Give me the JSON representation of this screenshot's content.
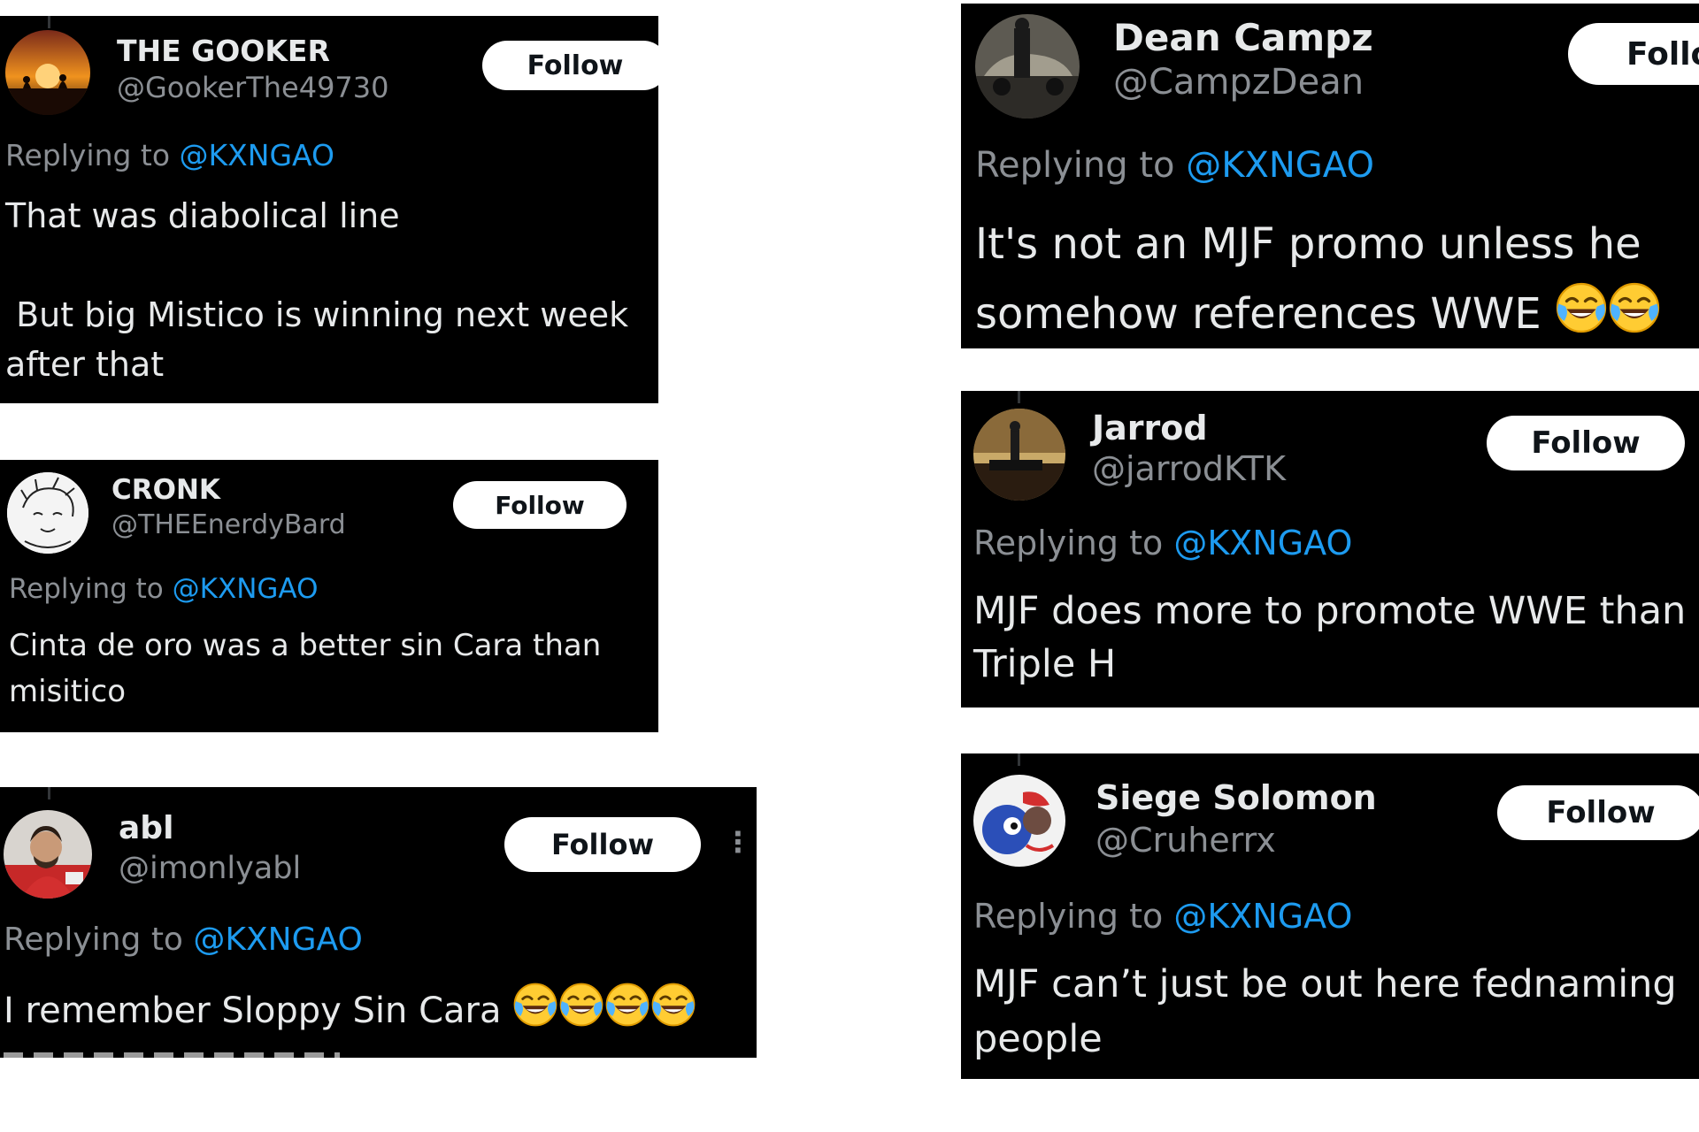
{
  "tweets": {
    "gooker": {
      "name": "THE GOOKER",
      "handle": "@GookerThe49730",
      "follow": "Follow",
      "replying_prefix": "Replying to ",
      "mention": "@KXNGAO",
      "line1": "That was diabolical line",
      "line2": " But big Mistico is winning next week",
      "line3": "after that"
    },
    "cronk": {
      "name": "CRONK",
      "handle": "@THEEnerdyBard",
      "follow": "Follow",
      "replying_prefix": "Replying to ",
      "mention": "@KXNGAO",
      "line1": "Cinta de oro was a better sin Cara than",
      "line2": "misitico"
    },
    "abl": {
      "name": "abl",
      "handle": "@imonlyabl",
      "follow": "Follow",
      "replying_prefix": "Replying to ",
      "mention": "@KXNGAO",
      "line1": "I remember Sloppy Sin Cara"
    },
    "dean": {
      "name": "Dean Campz",
      "handle": "@CampzDean",
      "follow": "Follo",
      "replying_prefix": "Replying to ",
      "mention": "@KXNGAO",
      "line1": "It's not an MJF promo unless he",
      "line2": "somehow references WWE"
    },
    "jarrod": {
      "name": "Jarrod",
      "handle": "@jarrodKTK",
      "follow": "Follow",
      "replying_prefix": "Replying to ",
      "mention": "@KXNGAO",
      "line1": "MJF does more to promote WWE than",
      "line2": "Triple H"
    },
    "siege": {
      "name": "Siege Solomon",
      "handle": "@Cruherrx",
      "follow": "Follow",
      "replying_prefix": "Replying to ",
      "mention": "@KXNGAO",
      "line1": "MJF can’t just be out here fednaming",
      "line2": "people"
    }
  },
  "icons": {
    "emoji": "face-with-tears-of-joy",
    "more": "more-options-icon"
  },
  "colors": {
    "card_bg": "#000000",
    "text": "#e7e9ea",
    "secondary": "#8b8f94",
    "mention": "#1d9bf0",
    "follow_bg": "#ffffff",
    "page_bg": "#ffffff"
  }
}
